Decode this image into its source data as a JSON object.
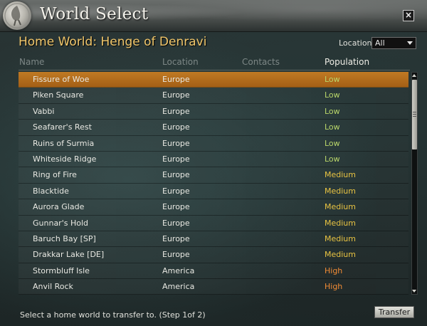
{
  "window": {
    "title": "World Select",
    "close_label": "×"
  },
  "home_world": "Home World: Henge of Denravi",
  "location_filter": {
    "label": "Location:",
    "selected": "All"
  },
  "columns": {
    "name": "Name",
    "location": "Location",
    "contacts": "Contacts",
    "population": "Population"
  },
  "population_colors": {
    "Low": "#b9d66a",
    "Medium": "#e8c342",
    "High": "#f08b35"
  },
  "selected_row": 0,
  "rows": [
    {
      "name": "Fissure of Woe",
      "location": "Europe",
      "contacts": "",
      "population": "Low"
    },
    {
      "name": "Piken Square",
      "location": "Europe",
      "contacts": "",
      "population": "Low"
    },
    {
      "name": "Vabbi",
      "location": "Europe",
      "contacts": "",
      "population": "Low"
    },
    {
      "name": "Seafarer's Rest",
      "location": "Europe",
      "contacts": "",
      "population": "Low"
    },
    {
      "name": "Ruins of Surmia",
      "location": "Europe",
      "contacts": "",
      "population": "Low"
    },
    {
      "name": "Whiteside Ridge",
      "location": "Europe",
      "contacts": "",
      "population": "Low"
    },
    {
      "name": "Ring of Fire",
      "location": "Europe",
      "contacts": "",
      "population": "Medium"
    },
    {
      "name": "Blacktide",
      "location": "Europe",
      "contacts": "",
      "population": "Medium"
    },
    {
      "name": "Aurora Glade",
      "location": "Europe",
      "contacts": "",
      "population": "Medium"
    },
    {
      "name": "Gunnar's Hold",
      "location": "Europe",
      "contacts": "",
      "population": "Medium"
    },
    {
      "name": "Baruch Bay [SP]",
      "location": "Europe",
      "contacts": "",
      "population": "Medium"
    },
    {
      "name": "Drakkar Lake [DE]",
      "location": "Europe",
      "contacts": "",
      "population": "Medium"
    },
    {
      "name": "Stormbluff Isle",
      "location": "America",
      "contacts": "",
      "population": "High"
    },
    {
      "name": "Anvil Rock",
      "location": "America",
      "contacts": "",
      "population": "High"
    }
  ],
  "status_text": "Select a home world to transfer to. (Step 1of 2)",
  "transfer_button": "Transfer"
}
